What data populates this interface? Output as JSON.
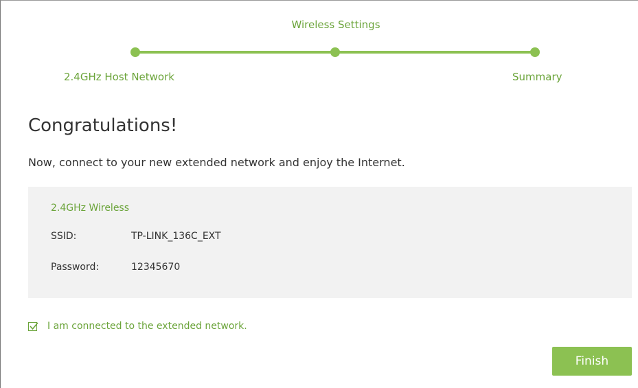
{
  "stepper": {
    "steps": [
      {
        "label": "2.4GHz Host Network"
      },
      {
        "label": "Wireless Settings"
      },
      {
        "label": "Summary"
      }
    ]
  },
  "main": {
    "heading": "Congratulations!",
    "subtext": "Now, connect to your new extended network and enjoy the Internet."
  },
  "info": {
    "title": "2.4GHz Wireless",
    "ssid_label": "SSID:",
    "ssid_value": "TP-LINK_136C_EXT",
    "password_label": "Password:",
    "password_value": "12345670"
  },
  "confirm": {
    "checked": true,
    "label": "I am connected to the extended network."
  },
  "actions": {
    "finish_label": "Finish"
  },
  "colors": {
    "accent": "#8cc152",
    "accent_text": "#6ba43a"
  },
  "icons": {
    "checkbox": "checkmark-icon"
  }
}
